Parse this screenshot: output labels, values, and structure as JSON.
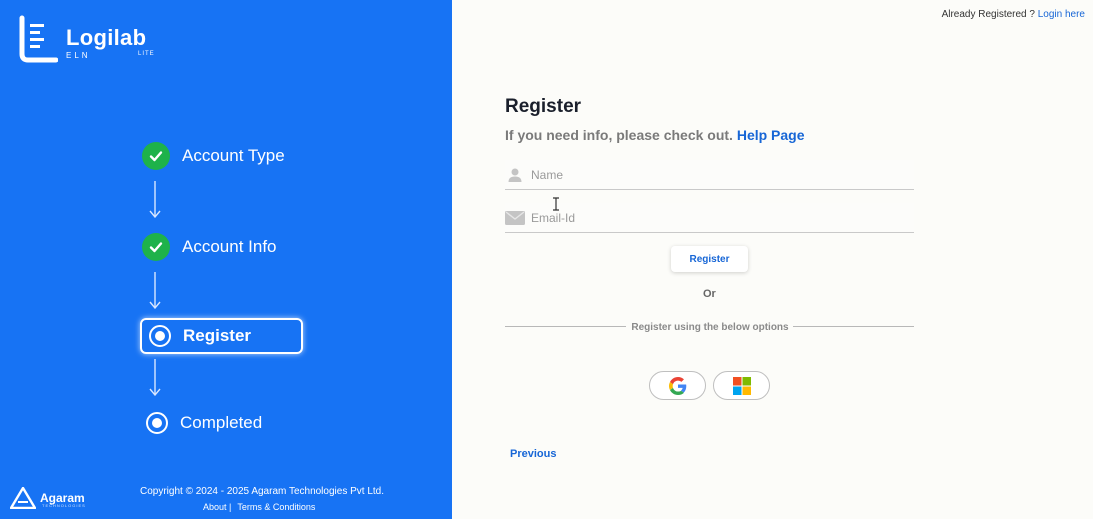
{
  "brand": {
    "name": "Logilab",
    "sub": "ELN",
    "tier": "LITE"
  },
  "steps": [
    {
      "label": "Account Type",
      "state": "completed"
    },
    {
      "label": "Account Info",
      "state": "completed"
    },
    {
      "label": "Register",
      "state": "active"
    },
    {
      "label": "Completed",
      "state": "pending"
    }
  ],
  "footer": {
    "company": "Agaram",
    "company_tag": "TECHNOLOGIES",
    "copyright": "Copyright © 2024 - 2025 Agaram Technologies Pvt Ltd.",
    "about": "About |",
    "terms": "Terms & Conditions"
  },
  "header": {
    "already_text": "Already Registered ?",
    "login_link": "Login here"
  },
  "form": {
    "title": "Register",
    "info_text": "If you need info, please check out.",
    "help_link": "Help Page",
    "name_placeholder": "Name",
    "email_placeholder": "Email-Id",
    "register_button": "Register",
    "or_text": "Or",
    "options_text": "Register using the below options",
    "previous": "Previous"
  },
  "colors": {
    "panel": "#1773f4",
    "accent": "#1766d6",
    "success": "#1eb24a"
  },
  "icons": [
    "check-icon",
    "radio-icon",
    "arrow-down-icon",
    "user-icon",
    "mail-icon",
    "google-icon",
    "microsoft-icon"
  ]
}
